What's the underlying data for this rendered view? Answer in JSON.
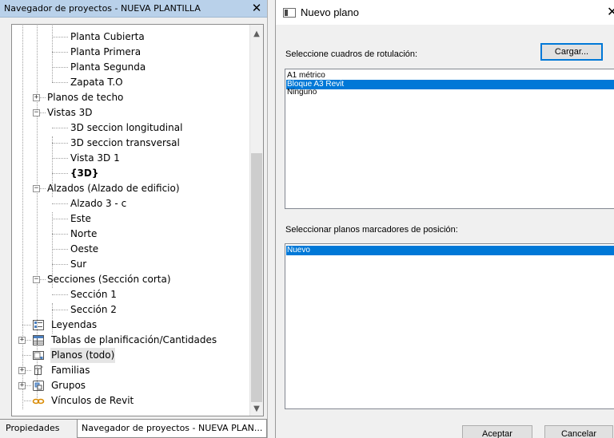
{
  "browser": {
    "title": "Navegador de proyectos - NUEVA PLANTILLA",
    "close_glyph": "✕",
    "items": [
      {
        "label": "Planta Cubierta",
        "level": 3,
        "icon": null,
        "expander": null
      },
      {
        "label": "Planta Primera",
        "level": 3,
        "icon": null,
        "expander": null
      },
      {
        "label": "Planta Segunda",
        "level": 3,
        "icon": null,
        "expander": null
      },
      {
        "label": "Zapata T.O",
        "level": 3,
        "icon": null,
        "expander": null
      },
      {
        "label": "Planos de techo",
        "level": 2,
        "icon": null,
        "expander": "plus"
      },
      {
        "label": "Vistas 3D",
        "level": 2,
        "icon": null,
        "expander": "minus"
      },
      {
        "label": "3D seccion longitudinal",
        "level": 3,
        "icon": null,
        "expander": null
      },
      {
        "label": "3D seccion transversal",
        "level": 3,
        "icon": null,
        "expander": null
      },
      {
        "label": "Vista 3D 1",
        "level": 3,
        "icon": null,
        "expander": null
      },
      {
        "label": "{3D}",
        "level": 3,
        "icon": null,
        "expander": null,
        "bold": true
      },
      {
        "label": "Alzados (Alzado de edificio)",
        "level": 2,
        "icon": null,
        "expander": "minus"
      },
      {
        "label": "Alzado 3 - c",
        "level": 3,
        "icon": null,
        "expander": null
      },
      {
        "label": "Este",
        "level": 3,
        "icon": null,
        "expander": null
      },
      {
        "label": "Norte",
        "level": 3,
        "icon": null,
        "expander": null
      },
      {
        "label": "Oeste",
        "level": 3,
        "icon": null,
        "expander": null
      },
      {
        "label": "Sur",
        "level": 3,
        "icon": null,
        "expander": null
      },
      {
        "label": "Secciones (Sección corta)",
        "level": 2,
        "icon": null,
        "expander": "minus"
      },
      {
        "label": "Sección 1",
        "level": 3,
        "icon": null,
        "expander": null
      },
      {
        "label": "Sección 2",
        "level": 3,
        "icon": null,
        "expander": null
      },
      {
        "label": "Leyendas",
        "level": 1,
        "icon": "legend-icon",
        "expander": null
      },
      {
        "label": "Tablas de planificación/Cantidades",
        "level": 1,
        "icon": "schedule-icon",
        "expander": "plus"
      },
      {
        "label": "Planos (todo)",
        "level": 1,
        "icon": "sheets-icon",
        "expander": null,
        "selected": true
      },
      {
        "label": "Familias",
        "level": 1,
        "icon": "families-icon",
        "expander": "plus"
      },
      {
        "label": "Grupos",
        "level": 1,
        "icon": "groups-icon",
        "expander": "plus"
      },
      {
        "label": "Vínculos de Revit",
        "level": 1,
        "icon": "revit-links-icon",
        "expander": null
      }
    ],
    "tabs": [
      "Propiedades",
      "Navegador de proyectos - NUEVA PLAN..."
    ],
    "active_tab": 1
  },
  "dialog": {
    "title": "Nuevo plano",
    "close_glyph": "✕",
    "title_blocks_label": "Seleccione cuadros de rotulación:",
    "load_button": "Cargar...",
    "title_blocks": [
      "A1 métrico",
      "Bloque A3 Revit",
      "Ninguno"
    ],
    "title_blocks_selected": 1,
    "placeholders_label": "Seleccionar planos marcadores de posición:",
    "placeholders": [
      "Nuevo"
    ],
    "placeholders_selected": 0,
    "ok_button": "Aceptar",
    "cancel_button": "Cancelar"
  },
  "colors": {
    "selection": "#0078d7",
    "browser_title_bg": "#b9d1ea",
    "panel_bg": "#f0f0f0"
  }
}
